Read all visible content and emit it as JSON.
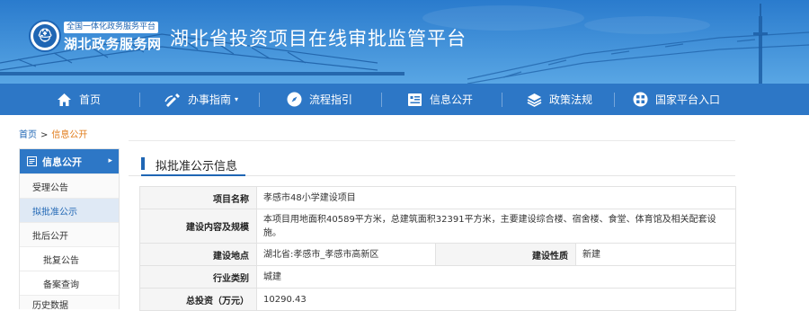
{
  "header": {
    "site_subtitle": "全国一体化政务服务平台",
    "site_name": "湖北政务服务网",
    "platform_title": "湖北省投资项目在线审批监管平台"
  },
  "nav": {
    "items": [
      {
        "label": "首页",
        "icon": "home-icon"
      },
      {
        "label": "办事指南",
        "icon": "guide-icon",
        "caret": "▾"
      },
      {
        "label": "流程指引",
        "icon": "compass-icon"
      },
      {
        "label": "信息公开",
        "icon": "info-icon"
      },
      {
        "label": "政策法规",
        "icon": "layers-icon"
      },
      {
        "label": "国家平台入口",
        "icon": "portal-icon"
      }
    ]
  },
  "breadcrumb": {
    "home": "首页",
    "separator": ">",
    "current": "信息公开"
  },
  "sidebar": {
    "header": "信息公开",
    "header_icon": "document-icon",
    "chevron": "▸",
    "items": [
      {
        "label": "受理公告"
      },
      {
        "label": "拟批准公示"
      },
      {
        "label": "批后公开"
      },
      {
        "label": "批复公告"
      },
      {
        "label": "备案查询"
      },
      {
        "label": "历史数据"
      }
    ]
  },
  "panel": {
    "title": "拟批准公示信息"
  },
  "details": {
    "project_name_label": "项目名称",
    "project_name": "孝感市48小学建设项目",
    "scope_label": "建设内容及规模",
    "scope": "本项目用地面积40589平方米，总建筑面积32391平方米，主要建设综合楼、宿舍楼、食堂、体育馆及相关配套设施。",
    "location_label": "建设地点",
    "location": "湖北省:孝感市_孝感市高新区",
    "nature_label": "建设性质",
    "nature": "新建",
    "industry_label": "行业类别",
    "industry": "城建",
    "investment_label": "总投资（万元）",
    "investment": "10290.43"
  },
  "colors": {
    "nav_bg": "#2d77c6",
    "accent": "#1f66b4",
    "breadcrumb_current": "#e07b1a",
    "sidebar_active_bg": "#dfe9f5"
  }
}
